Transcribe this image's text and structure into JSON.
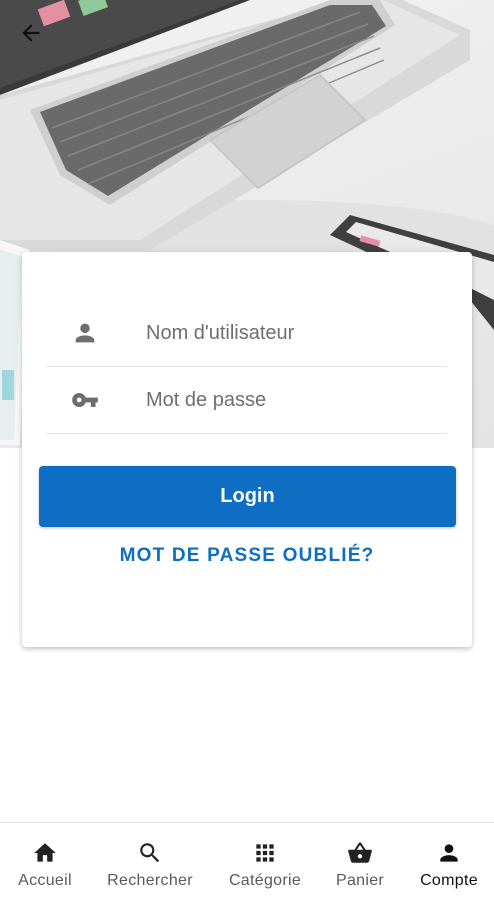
{
  "header": {
    "back_icon": "arrow-back-icon"
  },
  "login_form": {
    "username": {
      "icon": "person-icon",
      "value": "",
      "placeholder": "Nom d'utilisateur"
    },
    "password": {
      "icon": "key-icon",
      "value": "",
      "placeholder": "Mot de passe"
    },
    "login_label": "Login",
    "forgot_label": "MOT DE PASSE OUBLIÉ?"
  },
  "bottom_nav": {
    "items": [
      {
        "label": "Accueil",
        "icon": "home-icon",
        "active": false
      },
      {
        "label": "Rechercher",
        "icon": "search-icon",
        "active": false
      },
      {
        "label": "Catégorie",
        "icon": "grid-icon",
        "active": false
      },
      {
        "label": "Panier",
        "icon": "basket-icon",
        "active": false
      },
      {
        "label": "Compte",
        "icon": "account-icon",
        "active": true
      }
    ]
  },
  "colors": {
    "primary": "#0d6ec4",
    "text_muted": "#6f6f6f",
    "icon_gray": "#6e6e6e"
  }
}
